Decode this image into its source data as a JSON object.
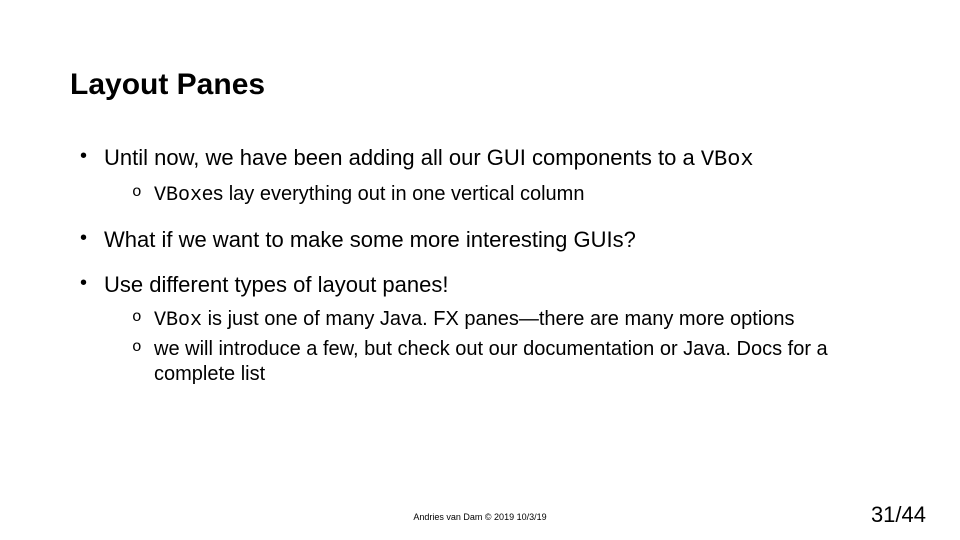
{
  "title": "Layout Panes",
  "bullets": {
    "b1_pre": "Until now, we have been adding all our GUI components to a ",
    "b1_code": "VBox",
    "b1_sub1_code": "VBox",
    "b1_sub1_rest": "es lay everything out in one vertical column",
    "b2": "What if we want to make some more interesting GUIs?",
    "b3": "Use different types of layout panes!",
    "b3_sub1_code": "VBox",
    "b3_sub1_rest": " is just one of many Java. FX panes—there are many more options",
    "b3_sub2": "we will introduce a few, but check out our documentation or Java. Docs for a complete list"
  },
  "footer": "Andries van Dam © 2019 10/3/19",
  "page": "31/44"
}
